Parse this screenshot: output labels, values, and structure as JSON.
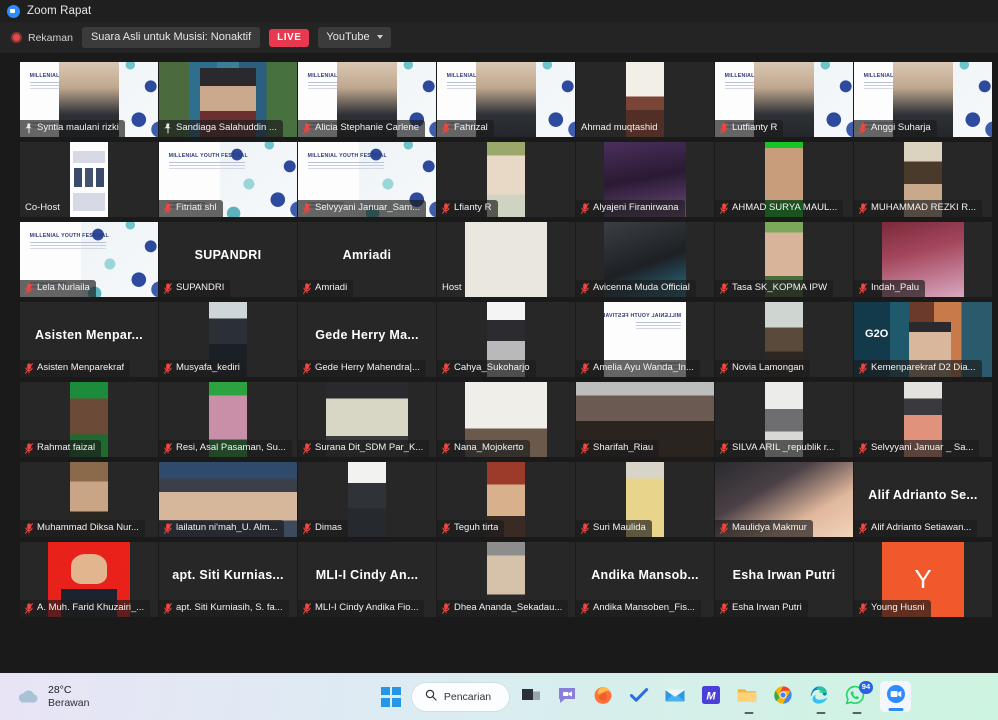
{
  "window": {
    "title": "Zoom Rapat",
    "app_icon": "zoom-logo-icon"
  },
  "topbar": {
    "recording_label": "Rekaman",
    "recording_icon": "recording-dot-icon",
    "audio_status": "Suara Asli untuk Musisi: Nonaktif",
    "live_badge": "LIVE",
    "stream_target": "YouTube",
    "stream_caret_icon": "chevron-down-icon"
  },
  "gallery": {
    "columns": 7,
    "rows": 7,
    "active_speaker_border_color": "#c8e05a",
    "mute_icon": "mic-muted-icon",
    "pin_icon": "pin-icon",
    "tiles": [
      {
        "name": "Syntia maulani rizki",
        "display": "label",
        "muted": false,
        "pinned": true,
        "media": "slide-person",
        "active": false
      },
      {
        "name": "Sandiaga Salahuddin ...",
        "display": "label",
        "muted": false,
        "pinned": true,
        "media": "collage-person",
        "active": true
      },
      {
        "name": "Alicia Stephanie Carlene",
        "display": "label",
        "muted": true,
        "media": "slide-person",
        "active": false
      },
      {
        "name": "Fahrizal",
        "display": "label",
        "muted": true,
        "media": "slide-person",
        "active": false
      },
      {
        "name": "Ahmad muqtashid",
        "display": "label-nobg",
        "muted": false,
        "media": "portrait-dark",
        "active": false
      },
      {
        "name": "Lutfianty R",
        "display": "label",
        "muted": true,
        "media": "slide-person",
        "active": false
      },
      {
        "name": "Anggi Suharja",
        "display": "label",
        "muted": true,
        "media": "slide-person",
        "active": false
      },
      {
        "name": "Co-Host",
        "display": "label-nobg",
        "muted": false,
        "media": "poster",
        "active": false
      },
      {
        "name": "Fitriati shl",
        "display": "label",
        "muted": true,
        "media": "slide",
        "active": false
      },
      {
        "name": "Selvyyani Januar_Sam...",
        "display": "label",
        "muted": true,
        "media": "slide",
        "active": false
      },
      {
        "name": "Lfianty R",
        "display": "label",
        "muted": true,
        "media": "portrait-hijab",
        "active": false
      },
      {
        "name": "Alyajeni Firanirwana",
        "display": "label",
        "muted": true,
        "media": "portrait-purple",
        "active": false
      },
      {
        "name": "AHMAD SURYA MAUL...",
        "display": "label",
        "muted": true,
        "media": "portrait-green",
        "active": false
      },
      {
        "name": "MUHAMMAD REZKI R...",
        "display": "label",
        "muted": true,
        "media": "portrait-tan",
        "active": false
      },
      {
        "name": "Lela Nurlaila",
        "display": "label",
        "muted": true,
        "media": "slide",
        "active": false
      },
      {
        "name": "SUPANDRI",
        "display": "bigname",
        "big": "SUPANDRI",
        "muted": true,
        "media": "none",
        "active": false
      },
      {
        "name": "Amriadi",
        "display": "bigname",
        "big": "Amriadi",
        "muted": true,
        "media": "none",
        "active": false
      },
      {
        "name": "Host",
        "display": "label-nobg",
        "muted": false,
        "media": "white-board",
        "active": false
      },
      {
        "name": "Avicenna Muda Official",
        "display": "label",
        "muted": true,
        "media": "portrait-dark2",
        "active": false
      },
      {
        "name": "Tasa SK_KOPMA IPW",
        "display": "label",
        "muted": true,
        "media": "portrait-green2",
        "active": false
      },
      {
        "name": "Indah_Palu",
        "display": "label",
        "muted": true,
        "media": "portrait-pink",
        "active": false
      },
      {
        "name": "Asisten Menparekraf",
        "display": "bigname",
        "big": "Asisten  Menpar...",
        "muted": true,
        "media": "none",
        "active": false
      },
      {
        "name": "Musyafa_kediri",
        "display": "label",
        "muted": true,
        "media": "portrait-dark3",
        "active": false
      },
      {
        "name": "Gede Herry Mahendra|...",
        "display": "bigname",
        "big": "Gede Herry Ma...",
        "muted": true,
        "media": "none",
        "active": false
      },
      {
        "name": "Cahya_Sukoharjo",
        "display": "label",
        "muted": true,
        "media": "portrait-white",
        "active": false
      },
      {
        "name": "Amelia Ayu Wanda_In...",
        "display": "label",
        "muted": true,
        "media": "slide-flipped",
        "active": false
      },
      {
        "name": "Novia Lamongan",
        "display": "label",
        "muted": true,
        "media": "portrait-room",
        "active": false
      },
      {
        "name": "Kemenparekraf D2 Dia...",
        "display": "label",
        "muted": true,
        "media": "g20-collage",
        "active": false
      },
      {
        "name": "Rahmat faizal",
        "display": "label",
        "muted": true,
        "media": "portrait-green3",
        "active": false
      },
      {
        "name": "Resi, Asal Pasaman, Su...",
        "display": "label",
        "muted": true,
        "media": "portrait-green4",
        "active": false
      },
      {
        "name": "Surana Dit_SDM Par_K...",
        "display": "label",
        "muted": true,
        "media": "portrait-car",
        "active": false
      },
      {
        "name": "Nana_Mojokerto",
        "display": "label",
        "muted": true,
        "media": "portrait-white2",
        "active": false
      },
      {
        "name": "Sharifah_Riau",
        "display": "label",
        "muted": true,
        "media": "wide-gray",
        "active": false
      },
      {
        "name": "SILVA ARIL _republik r...",
        "display": "label",
        "muted": true,
        "media": "portrait-blur",
        "active": false
      },
      {
        "name": "Selvyyani Januar _ Sa...",
        "display": "label",
        "muted": true,
        "media": "portrait-peach",
        "active": false
      },
      {
        "name": "Muhammad Diksa Nur...",
        "display": "label",
        "muted": true,
        "media": "portrait-brown",
        "active": false
      },
      {
        "name": "lailatun ni'mah_U. Alm...",
        "display": "label",
        "muted": true,
        "media": "wide-hijab",
        "active": false
      },
      {
        "name": "Dimas",
        "display": "label",
        "muted": true,
        "media": "portrait-white3",
        "active": false
      },
      {
        "name": "Teguh tirta",
        "display": "label",
        "muted": true,
        "media": "portrait-red",
        "active": false
      },
      {
        "name": "Suri Maulida",
        "display": "label",
        "muted": true,
        "media": "portrait-yellow",
        "active": false
      },
      {
        "name": "Maulidya Makmur",
        "display": "label",
        "muted": true,
        "media": "wide-closeup",
        "active": false
      },
      {
        "name": "Alif Adrianto Setiawan...",
        "display": "bigname",
        "big": "Alif  Adrianto  Se...",
        "muted": true,
        "media": "none",
        "active": false
      },
      {
        "name": "A. Muh. Farid Khuzairi_...",
        "display": "label",
        "muted": true,
        "media": "portrait-redbg",
        "active": false
      },
      {
        "name": "apt. Siti Kurniasih, S. fa...",
        "display": "bigname",
        "big": "apt. Siti Kurnias...",
        "muted": true,
        "media": "none",
        "active": false
      },
      {
        "name": "MLI-I Cindy Andika Fio...",
        "display": "bigname",
        "big": "MLI-I Cindy An...",
        "muted": true,
        "media": "none",
        "active": false
      },
      {
        "name": "Dhea Ananda_Sekadau...",
        "display": "label",
        "muted": true,
        "media": "portrait-gray",
        "active": false
      },
      {
        "name": "Andika Mansoben_Fis...",
        "display": "bigname",
        "big": "Andika  Mansob...",
        "muted": true,
        "media": "none",
        "active": false
      },
      {
        "name": "Esha Irwan Putri",
        "display": "bigname",
        "big": "Esha Irwan Putri",
        "muted": true,
        "media": "none",
        "active": false
      },
      {
        "name": "Young Husni",
        "display": "label",
        "muted": true,
        "media": "avatar-y",
        "avatar_letter": "Y",
        "active": false
      }
    ]
  },
  "taskbar": {
    "weather": {
      "temperature": "28°C",
      "condition": "Berawan",
      "icon": "cloud-icon"
    },
    "start_icon": "windows-start-icon",
    "search": {
      "label": "Pencarian",
      "icon": "search-icon"
    },
    "apps": [
      {
        "name": "task-view",
        "icon": "task-view-icon",
        "running": false,
        "badge": null
      },
      {
        "name": "chat",
        "icon": "chat-bubble-icon",
        "running": false,
        "badge": null
      },
      {
        "name": "firefox",
        "icon": "firefox-icon",
        "running": false,
        "badge": null
      },
      {
        "name": "todo",
        "icon": "checkmark-icon",
        "running": false,
        "badge": null
      },
      {
        "name": "mail",
        "icon": "envelope-icon",
        "running": false,
        "badge": null
      },
      {
        "name": "m-app",
        "icon": "m-letter-icon",
        "running": false,
        "badge": null
      },
      {
        "name": "file-explorer",
        "icon": "folder-icon",
        "running": true,
        "badge": null
      },
      {
        "name": "chrome",
        "icon": "chrome-icon",
        "running": false,
        "badge": null
      },
      {
        "name": "edge",
        "icon": "edge-icon",
        "running": true,
        "badge": null
      },
      {
        "name": "whatsapp",
        "icon": "whatsapp-icon",
        "running": true,
        "badge": "94"
      },
      {
        "name": "zoom",
        "icon": "zoom-icon",
        "running": true,
        "badge": null,
        "active": true
      }
    ]
  }
}
